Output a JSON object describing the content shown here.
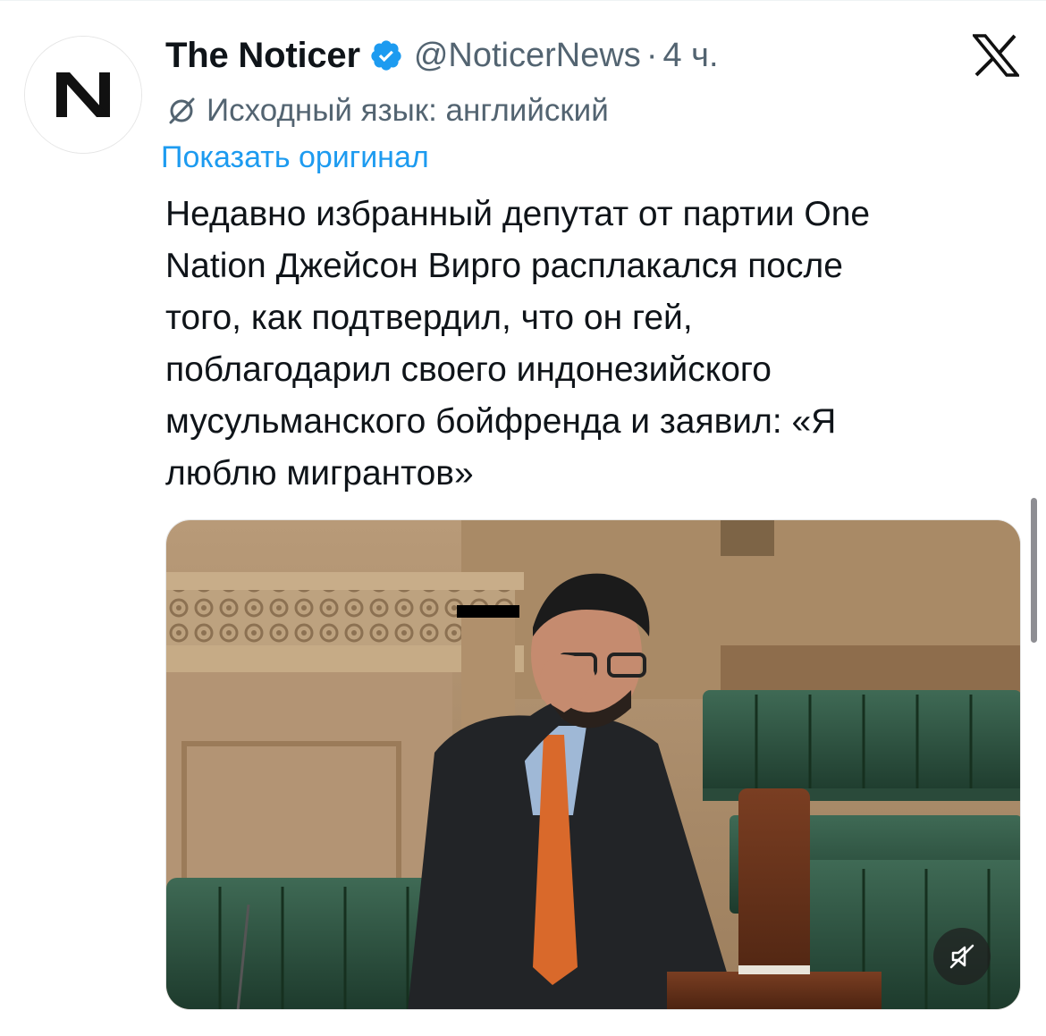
{
  "account": {
    "display_name": "The Noticer",
    "handle": "@NoticerNews",
    "separator": "·",
    "time": "4 ч.",
    "avatar_letter": "N",
    "verified": true
  },
  "translation": {
    "label": "Исходный язык: английский",
    "show_original": "Показать оригинал"
  },
  "tweet": {
    "lines": [
      "Недавно избранный депутат от партии One",
      "Nation Джейсон Вирго расплакался после",
      "того, как подтвердил, что он гей,",
      "поблагодарил своего индонезийского",
      "мусульманского бойфренда и заявил: «Я",
      "люблю мигрантов»"
    ]
  },
  "media": {
    "type": "video",
    "muted": true
  },
  "icons": {
    "verified": "verified-badge-icon",
    "platform": "x-logo-icon",
    "translate": "translate-icon",
    "mute": "speaker-muted-icon"
  },
  "colors": {
    "link": "#1d9bf0",
    "secondary_text": "#536471",
    "primary_text": "#0f1419",
    "verified": "#1d9bf0"
  }
}
